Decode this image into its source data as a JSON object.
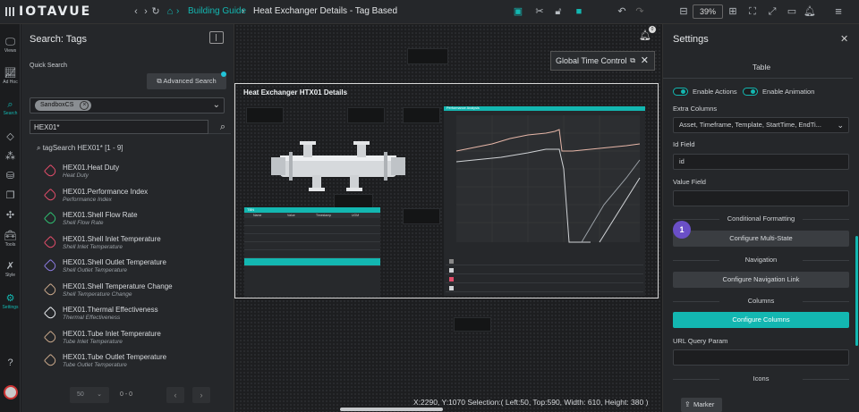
{
  "app": {
    "logo_text": "IOTAVUE"
  },
  "topbar": {
    "breadcrumb_root": "Building Guide",
    "breadcrumb_sep": "›",
    "breadcrumb_current": "Heat Exchanger Details - Tag Based",
    "zoom": "39%"
  },
  "rail": {
    "views": "Views",
    "adhoc": "Ad Hoc",
    "search": "Search",
    "tools": "Tools",
    "style": "Style",
    "settings": "Settings"
  },
  "search_panel": {
    "title": "Search: Tags",
    "quick_search_label": "Quick Search",
    "advanced_search": "Advanced Search",
    "filter_chip": "SandboxCS",
    "query": "HEX01*",
    "tag_search_result": "tagSearch HEX01* [1 - 9]",
    "items": [
      {
        "name": "HEX01.Heat Duty",
        "desc": "Heat Duty",
        "color": "#e24d6a"
      },
      {
        "name": "HEX01.Performance Index",
        "desc": "Performance Index",
        "color": "#e24d6a"
      },
      {
        "name": "HEX01.Shell Flow Rate",
        "desc": "Shell Flow Rate",
        "color": "#2fbf71"
      },
      {
        "name": "HEX01.Shell Inlet Temperature",
        "desc": "Shell Inlet Temperature",
        "color": "#e24d6a"
      },
      {
        "name": "HEX01.Shell Outlet Temperature",
        "desc": "Shell Outlet Temperature",
        "color": "#8b7be0"
      },
      {
        "name": "HEX01.Shell Temperature Change",
        "desc": "Shell Temperature Change",
        "color": "#c9a88a"
      },
      {
        "name": "HEX01.Thermal Effectiveness",
        "desc": "Thermal Effectiveness",
        "color": "#e9ecef"
      },
      {
        "name": "HEX01.Tube Inlet Temperature",
        "desc": "Tube Inlet Temperature",
        "color": "#c9a88a"
      },
      {
        "name": "HEX01.Tube Outlet Temperature",
        "desc": "Tube Outlet Temperature",
        "color": "#c9a88a"
      }
    ],
    "page_size": "50",
    "page_count": "0 - 0"
  },
  "canvas": {
    "global_time_control": "Global Time Control",
    "notification_count": "0",
    "widget_title": "Heat Exchanger HTX01 Details",
    "status_bar": "X:2290, Y:1070  Selection:( Left:50, Top:590, Width: 610, Height: 380 )",
    "perf_title": "Performance Analysis",
    "table_title": "TBN",
    "table_cols": [
      "Name",
      "Value",
      "Timestamp",
      "UOM"
    ]
  },
  "settings": {
    "title": "Settings",
    "subtitle": "Table",
    "enable_actions": "Enable Actions",
    "enable_animation": "Enable Animation",
    "extra_columns_label": "Extra Columns",
    "extra_columns_value": "Asset, Timeframe, Template, StartTime, EndTi...",
    "id_field_label": "Id Field",
    "id_field_value": "id",
    "value_field_label": "Value Field",
    "value_field_value": "",
    "cond_format": "Conditional Formatting",
    "step_number": "1",
    "configure_multistate": "Configure Multi-State",
    "navigation": "Navigation",
    "configure_navigation": "Configure Navigation Link",
    "columns": "Columns",
    "configure_columns": "Configure Columns",
    "url_query_label": "URL Query Param",
    "url_query_value": "",
    "icons": "Icons",
    "marker": "Marker"
  },
  "colors": {
    "accent": "#13b7b1",
    "badge": "#6a4fc7"
  }
}
